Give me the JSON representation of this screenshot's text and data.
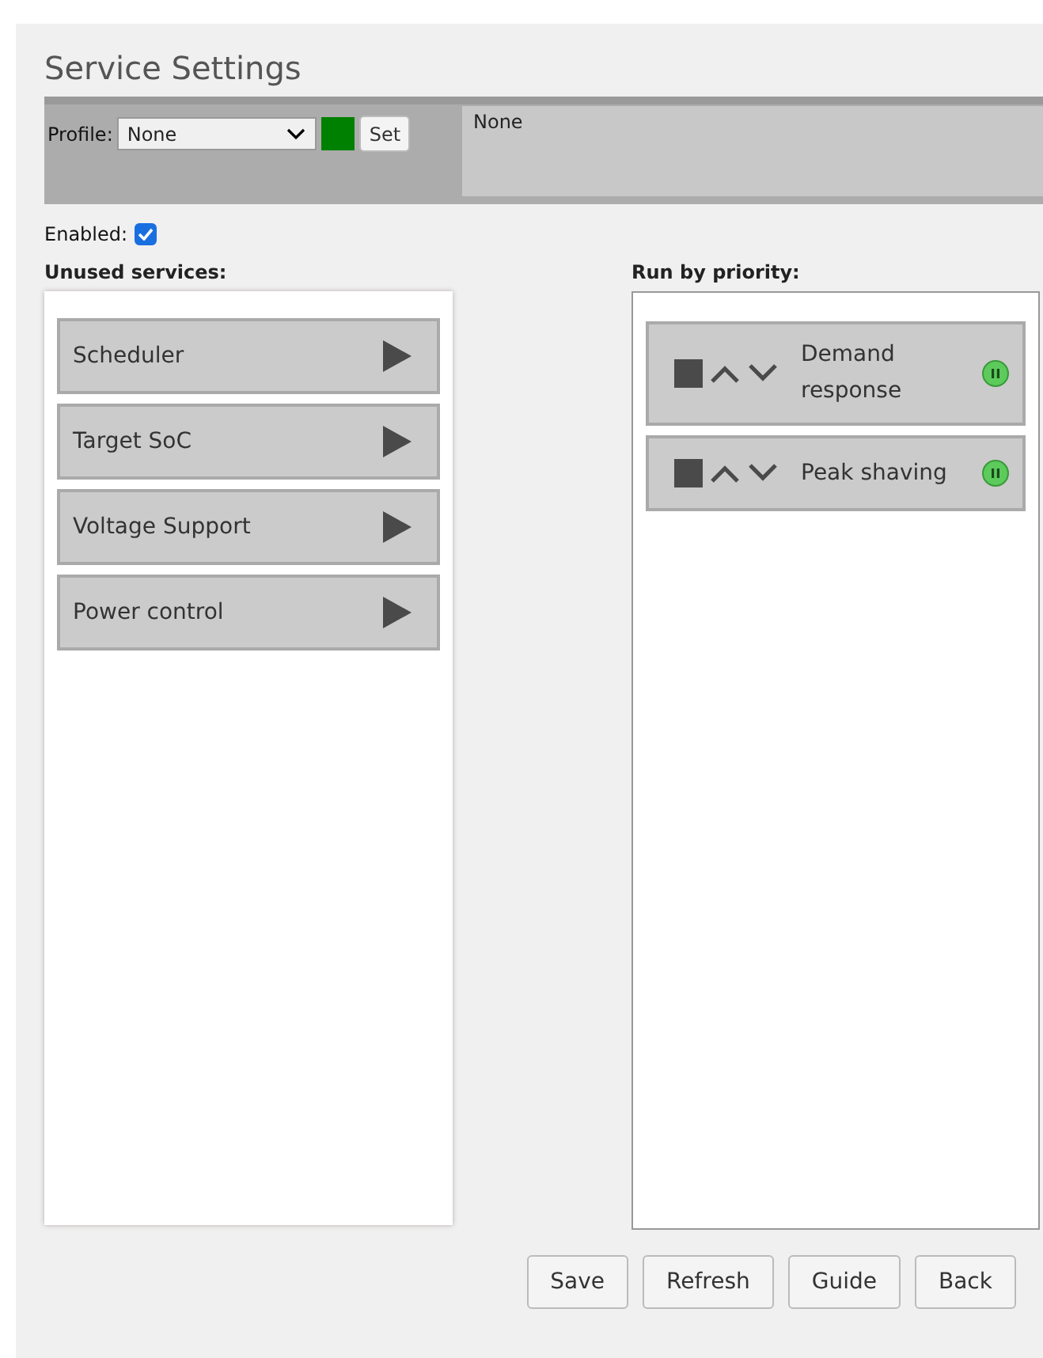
{
  "title": "Service Settings",
  "profile": {
    "label": "Profile:",
    "value": "None",
    "color": "#008000",
    "button": "Set",
    "description": "None"
  },
  "enabled": {
    "label": "Enabled:",
    "checked": true
  },
  "unused": {
    "label": "Unused services:",
    "items": [
      {
        "name": "Scheduler"
      },
      {
        "name": "Target SoC"
      },
      {
        "name": "Voltage Support"
      },
      {
        "name": "Power control"
      }
    ]
  },
  "priority": {
    "label": "Run by priority:",
    "items": [
      {
        "name": "Demand response",
        "running": true
      },
      {
        "name": "Peak shaving",
        "running": true
      }
    ]
  },
  "buttons": [
    "Save",
    "Refresh",
    "Guide",
    "Back"
  ]
}
